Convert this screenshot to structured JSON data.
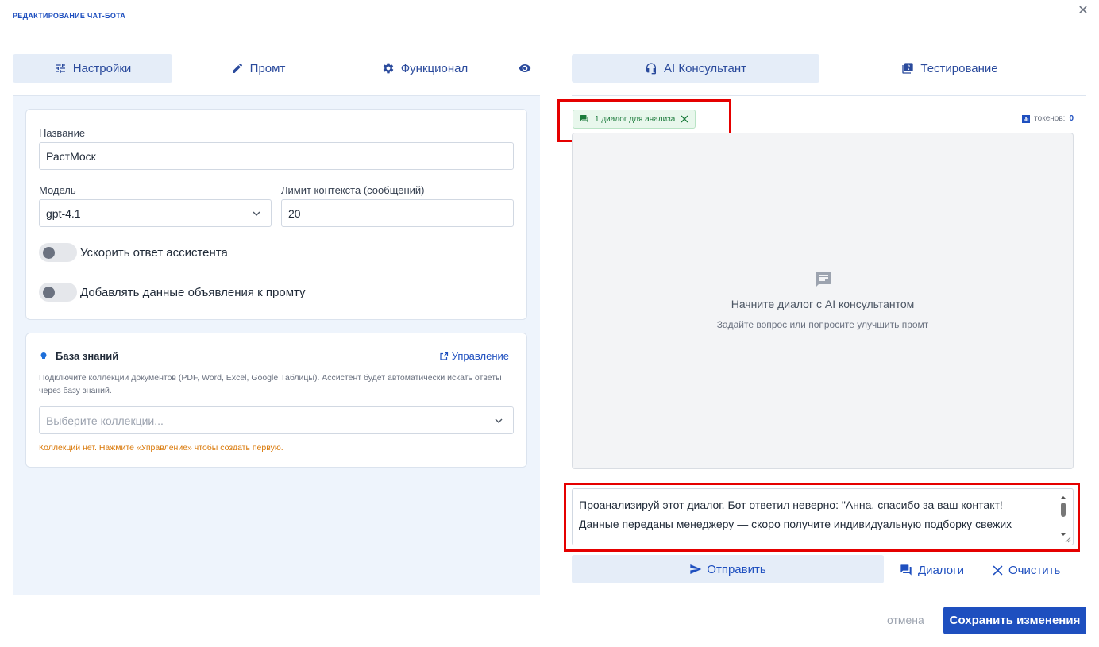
{
  "dialog": {
    "title": "РЕДАКТИРОВАНИЕ ЧАТ-БОТА",
    "close_icon": "close-icon"
  },
  "left_tabs": [
    {
      "label": "Настройки",
      "icon": "sliders-icon",
      "active": true
    },
    {
      "label": "Промт",
      "icon": "pencil-icon",
      "active": false
    },
    {
      "label": "Функционал",
      "icon": "gear-icon",
      "active": false
    },
    {
      "label": "",
      "icon": "eye-icon",
      "active": false
    }
  ],
  "settings": {
    "name_label": "Название",
    "name_value": "РастМоск",
    "model_label": "Модель",
    "model_value": "gpt-4.1",
    "context_label": "Лимит контекста (сообщений)",
    "context_value": "20",
    "toggle1_label": "Ускорить ответ ассистента",
    "toggle2_label": "Добавлять данные объявления к промту"
  },
  "knowledge": {
    "title": "База знаний",
    "manage_label": "Управление",
    "description": "Подключите коллекции документов (PDF, Word, Excel, Google Таблицы). Ассистент будет автоматически искать ответы через базу знаний.",
    "select_placeholder": "Выберите коллекции...",
    "warning": "Коллекций нет. Нажмите «Управление» чтобы создать первую."
  },
  "right_tabs": [
    {
      "label": "AI Консультант",
      "icon": "headset-icon",
      "active": true
    },
    {
      "label": "Тестирование",
      "icon": "quiz-icon",
      "active": false
    }
  ],
  "consultant": {
    "chip_label": "1 диалог для анализа",
    "tokens_label": "токенов:",
    "tokens_value": "0",
    "empty_title": "Начните диалог с AI консультантом",
    "empty_subtitle": "Задайте вопрос или попросите улучшить промт",
    "message_text": "Проанализируй этот диалог. Бот ответил неверно: \"Анна, спасибо за ваш контакт! Данные переданы менеджеру — скоро получите индивидуальную подборку свежих",
    "send_label": "Отправить",
    "dialogs_label": "Диалоги",
    "clear_label": "Очистить"
  },
  "footer": {
    "cancel_label": "отмена",
    "save_label": "Сохранить изменения"
  },
  "colors": {
    "accent": "#1e4fbf",
    "tab_active_bg": "#e5edf8",
    "panel_bg": "#eef4fc",
    "highlight": "#e50000",
    "chip_green": "#1a7a3a",
    "warning": "#d97706"
  }
}
